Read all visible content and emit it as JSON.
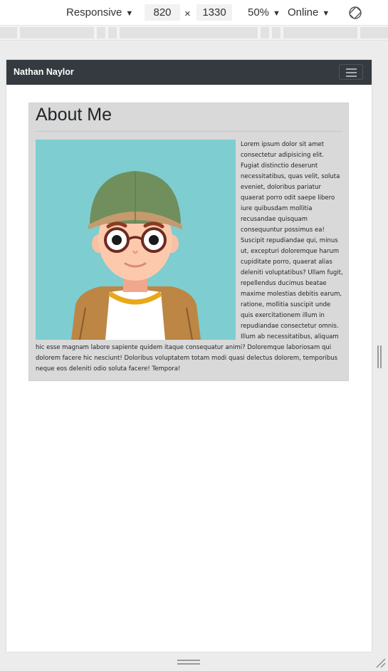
{
  "devtools": {
    "device_label": "Responsive",
    "width": "820",
    "times": "×",
    "height": "1330",
    "zoom": "50%",
    "network": "Online",
    "rotate_icon": "rotate-icon"
  },
  "navbar": {
    "brand": "Nathan Naylor",
    "toggler_icon": "hamburger-icon"
  },
  "about": {
    "title": "About Me",
    "avatar": "avatar-illustration",
    "body": "Lorem ipsum dolor sit amet consectetur adipisicing elit. Fugiat distinctio deserunt necessitatibus, quas velit, soluta eveniet, doloribus pariatur quaerat porro odit saepe libero iure quibusdam mollitia recusandae quisquam consequuntur possimus ea! Suscipit repudiandae qui, minus ut, excepturi doloremque harum cupiditate porro, quaerat alias deleniti voluptatibus? Ullam fugit, repellendus ducimus beatae maxime molestias debitis earum, ratione, mollitia suscipit unde quis exercitationem illum in repudiandae consectetur omnis. Illum ab necessitatibus, aliquam hic esse magnam labore sapiente quidem itaque consequatur animi? Doloremque laboriosam qui dolorem facere hic nesciunt! Doloribus voluptatem totam modi quasi delectus dolorem, temporibus neque eos deleniti odio soluta facere! Tempora!"
  },
  "colors": {
    "navbar_bg": "#343a40",
    "card_bg": "#d9d9d9",
    "avatar_bg": "#7ecdd0"
  }
}
